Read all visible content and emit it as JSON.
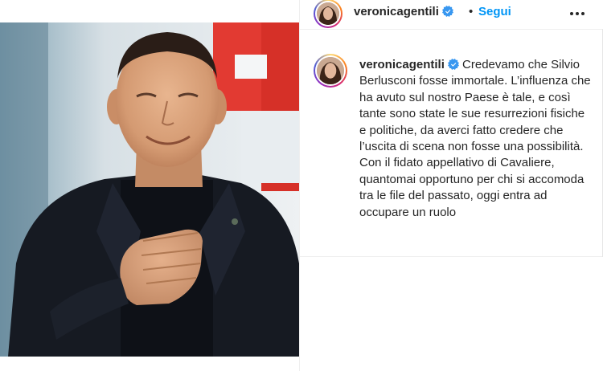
{
  "post": {
    "username": "veronicagentili",
    "follow_label": "Segui",
    "separator": "•",
    "caption_paragraph_1": "Credevamo che Silvio Berlusconi fosse immortale. L’influenza che ha avuto sul nostro Paese è tale, e così tante sono state le sue resurrezioni fisiche e politiche, da averci fatto credere che l’uscita di scena non fosse una possibilità.",
    "caption_paragraph_2": "Con il fidato appellativo di Cavaliere, quantomai opportuno per chi si accomoda tra le file del passato, oggi entra ad occupare un ruolo"
  },
  "icons": {
    "verified": "verified-badge-icon",
    "more": "more-options-icon"
  },
  "colors": {
    "follow": "#0095f6",
    "verified": "#3897f0",
    "text": "#262626"
  }
}
